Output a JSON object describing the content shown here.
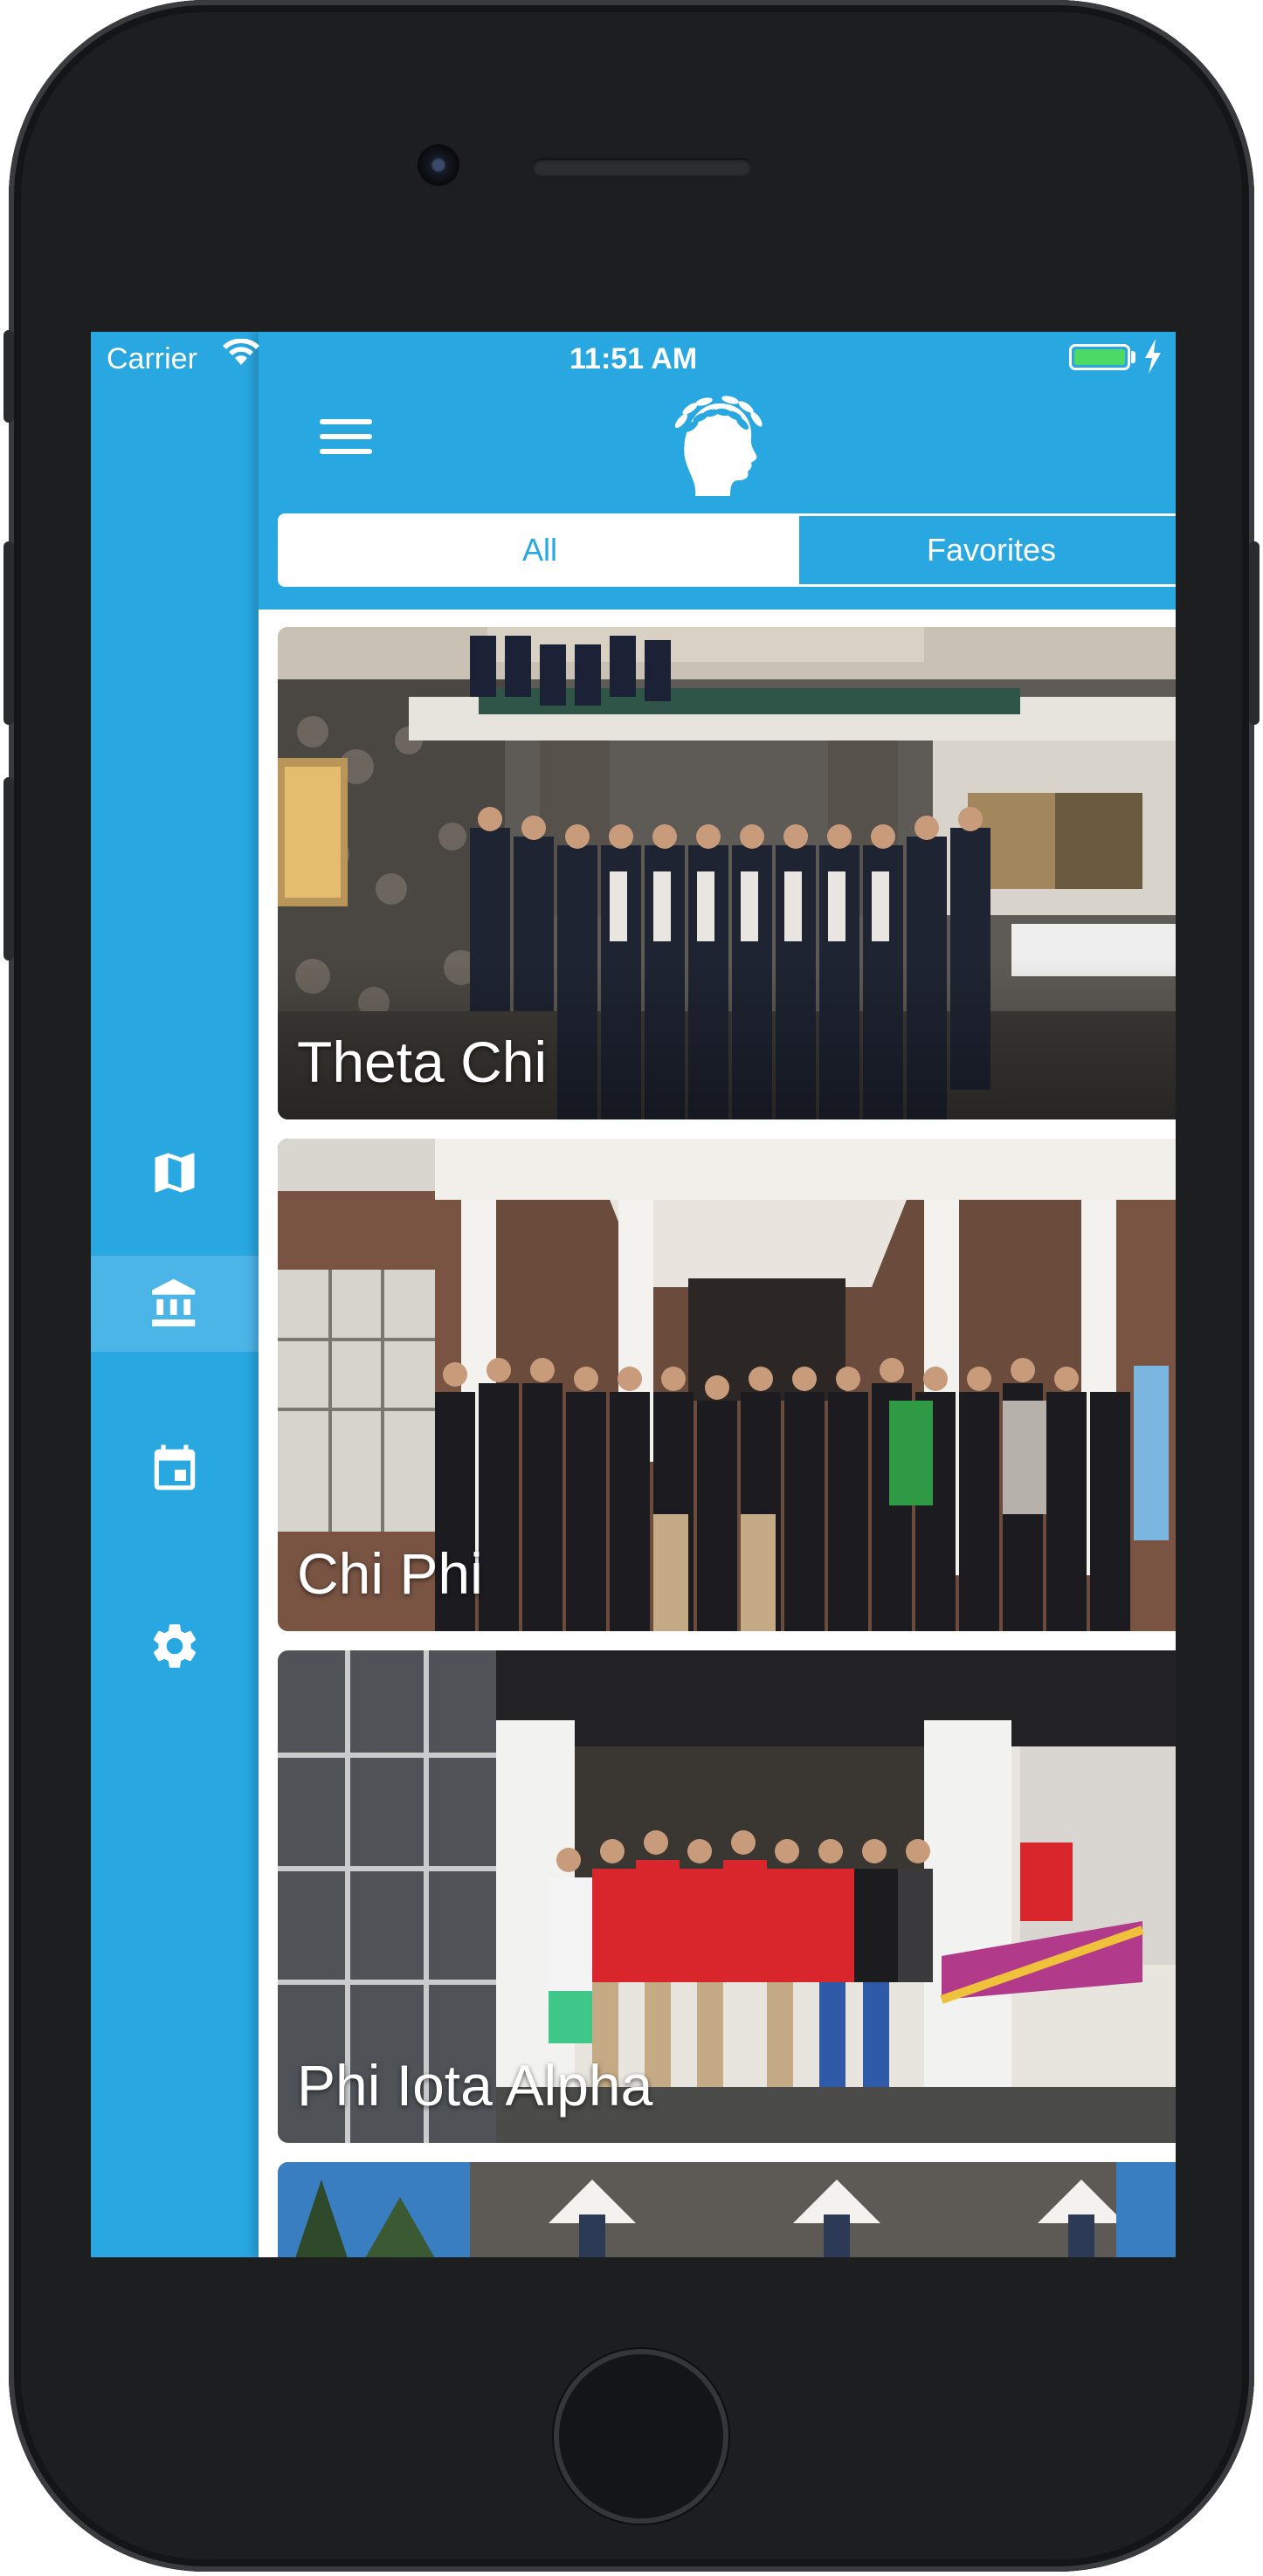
{
  "status_bar": {
    "carrier": "Carrier",
    "time": "11:51 AM",
    "battery_color": "#4cd964"
  },
  "theme": {
    "primary": "#29a7e1",
    "sidebar_active": "#4cb5e8"
  },
  "sidebar": {
    "items": [
      {
        "icon": "map-icon",
        "active": false
      },
      {
        "icon": "building-icon",
        "active": true
      },
      {
        "icon": "calendar-icon",
        "active": false
      },
      {
        "icon": "gear-icon",
        "active": false
      }
    ]
  },
  "header": {
    "menu_icon": "hamburger-menu-icon",
    "logo_icon": "laurel-head-logo-icon"
  },
  "segments": {
    "all_label": "All",
    "favorites_label": "Favorites",
    "selected": "All"
  },
  "houses": [
    {
      "name": "Theta Chi"
    },
    {
      "name": "Chi Phi"
    },
    {
      "name": "Phi Iota Alpha"
    },
    {
      "name": ""
    }
  ]
}
